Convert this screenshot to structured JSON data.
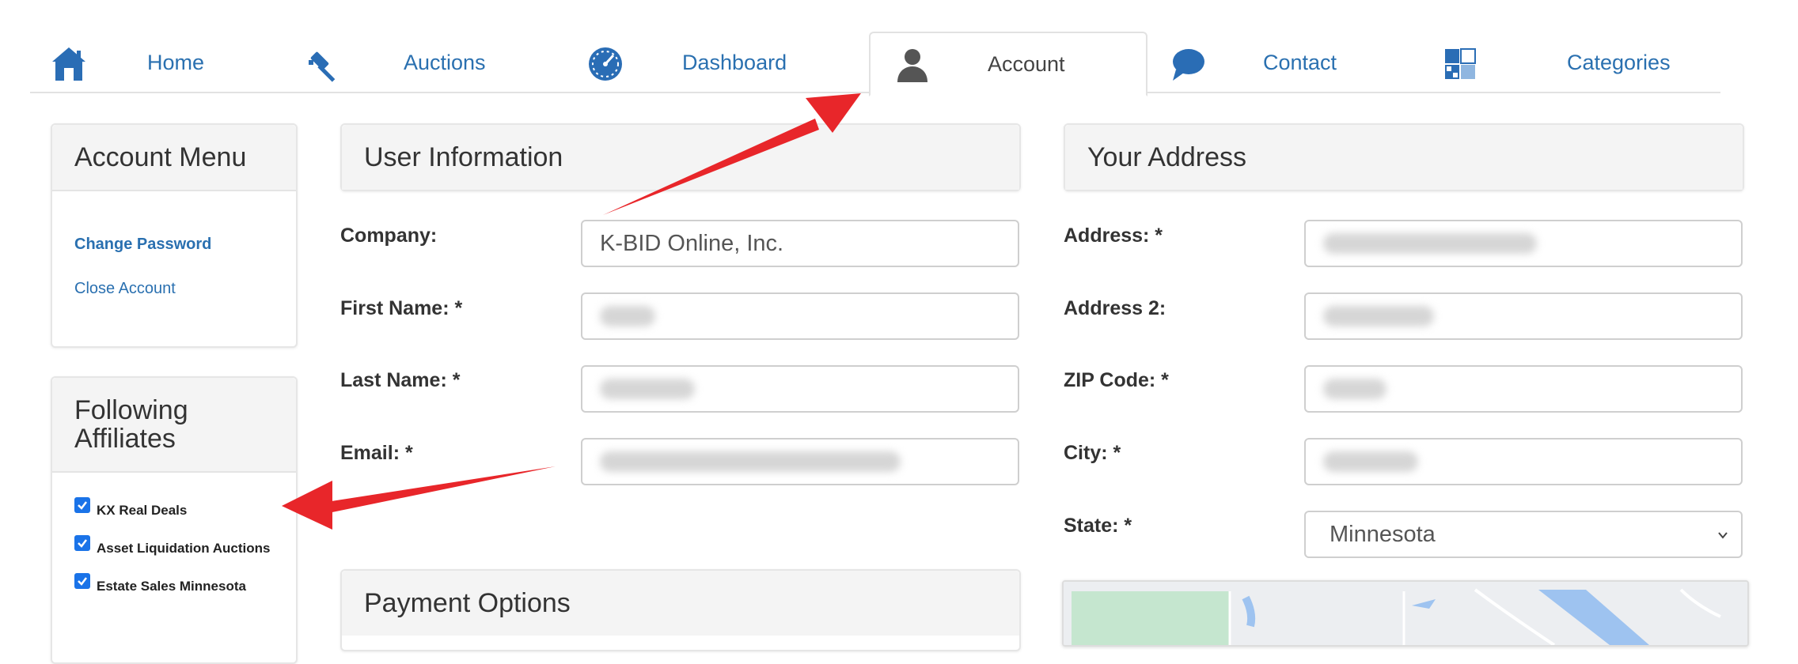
{
  "nav": {
    "tabs": [
      {
        "label": "Home",
        "icon": "home-icon"
      },
      {
        "label": "Auctions",
        "icon": "gavel-icon"
      },
      {
        "label": "Dashboard",
        "icon": "gauge-icon"
      },
      {
        "label": "Account",
        "icon": "user-icon"
      },
      {
        "label": "Contact",
        "icon": "chat-bubble-icon"
      },
      {
        "label": "Categories",
        "icon": "grid-icon"
      }
    ],
    "active": "Account"
  },
  "account_menu": {
    "title": "Account Menu",
    "items": [
      "Change Password",
      "Close Account"
    ]
  },
  "affiliates": {
    "title_line1": "Following",
    "title_line2": "Affiliates",
    "items": [
      {
        "label": "KX Real Deals",
        "checked": true
      },
      {
        "label": "Asset Liquidation Auctions",
        "checked": true
      },
      {
        "label": "Estate Sales Minnesota",
        "checked": true
      }
    ]
  },
  "user_info": {
    "title": "User Information",
    "company_label": "Company:",
    "company_value": "K-BID Online, Inc.",
    "first_name_label": "First Name: *",
    "last_name_label": "Last Name: *",
    "email_label": "Email: *"
  },
  "payment": {
    "title": "Payment Options"
  },
  "address": {
    "title": "Your Address",
    "address_label": "Address: *",
    "address2_label": "Address 2:",
    "zip_label": "ZIP Code: *",
    "city_label": "City: *",
    "state_label": "State: *",
    "state_value": "Minnesota"
  },
  "colors": {
    "link": "#2a70b0",
    "annotation_arrow": "#e8262a",
    "checkbox": "#1a73e8",
    "panel_header_bg": "#f4f4f4"
  }
}
